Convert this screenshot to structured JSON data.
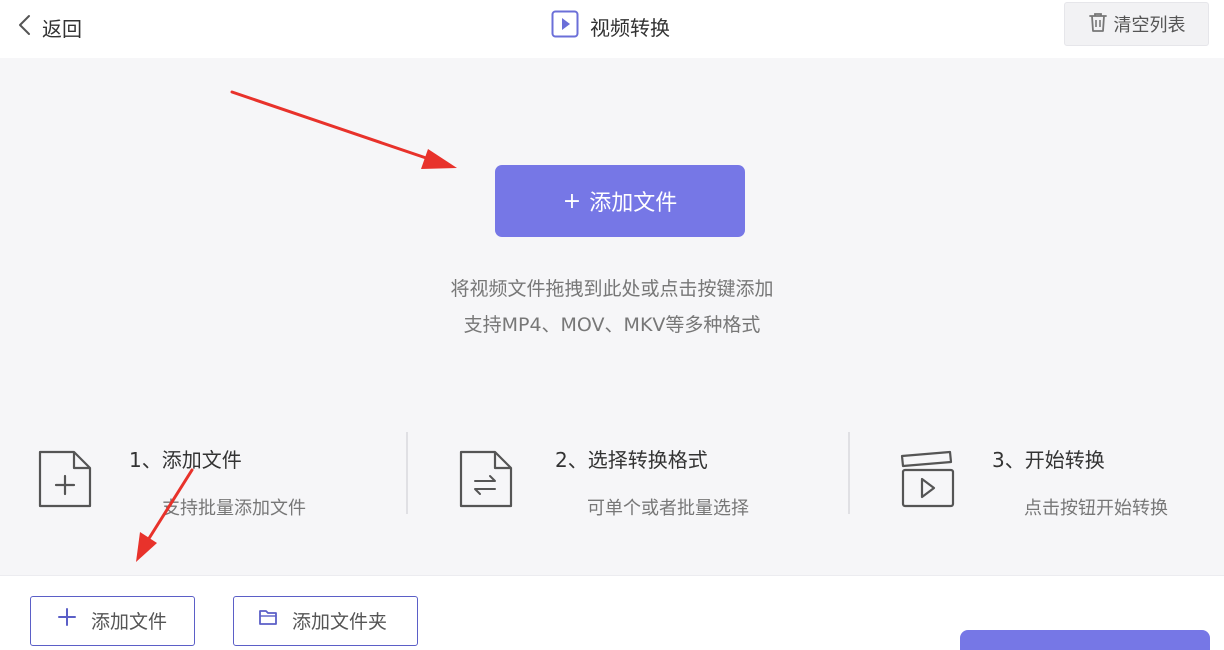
{
  "header": {
    "back_label": "返回",
    "title": "视频转换",
    "clear_label": "清空列表"
  },
  "dropzone": {
    "add_button_plus": "+",
    "add_button_label": "添加文件",
    "hint_line1": "将视频文件拖拽到此处或点击按键添加",
    "hint_line2": "支持MP4、MOV、MKV等多种格式"
  },
  "steps": [
    {
      "title": "1、添加文件",
      "subtitle": "支持批量添加文件",
      "icon": "file-add-icon"
    },
    {
      "title": "2、选择转换格式",
      "subtitle": "可单个或者批量选择",
      "icon": "file-convert-icon"
    },
    {
      "title": "3、开始转换",
      "subtitle": "点击按钮开始转换",
      "icon": "clapperboard-play-icon"
    }
  ],
  "toolbar": {
    "add_file_label": "添加文件",
    "add_folder_label": "添加文件夹"
  },
  "colors": {
    "accent": "#7677e6",
    "annotation_arrow": "#e8322b",
    "background": "#f6f6f8"
  }
}
